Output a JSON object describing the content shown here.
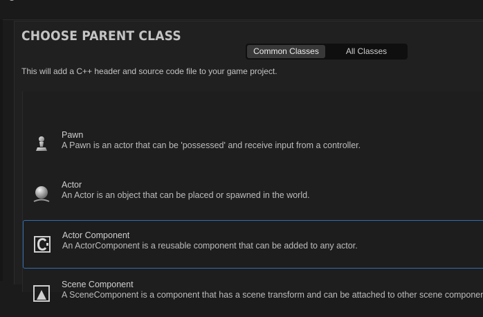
{
  "dialog": {
    "title": "CHOOSE PARENT CLASS",
    "description": "This will add a C++ header and source code file to your game project."
  },
  "tabs": [
    {
      "label": "Common Classes",
      "active": true
    },
    {
      "label": "All Classes",
      "active": false
    }
  ],
  "classes": [
    {
      "name": "Pawn",
      "description": "A Pawn is an actor that can be 'possessed' and receive input from a controller.",
      "icon": "pawn-icon",
      "selected": false
    },
    {
      "name": "Actor",
      "description": "An Actor is an object that can be placed or spawned in the world.",
      "icon": "actor-sphere-icon",
      "selected": false
    },
    {
      "name": "Actor Component",
      "description": "An ActorComponent is a reusable component that can be added to any actor.",
      "icon": "actor-component-icon",
      "selected": true
    },
    {
      "name": "Scene Component",
      "description": "A SceneComponent is a component that has a scene transform and can be attached to other scene components.",
      "icon": "scene-component-icon",
      "selected": false
    }
  ],
  "colors": {
    "selection_border": "#2f6fb7",
    "panel_bg": "#202020",
    "segment_active": "#383838"
  }
}
